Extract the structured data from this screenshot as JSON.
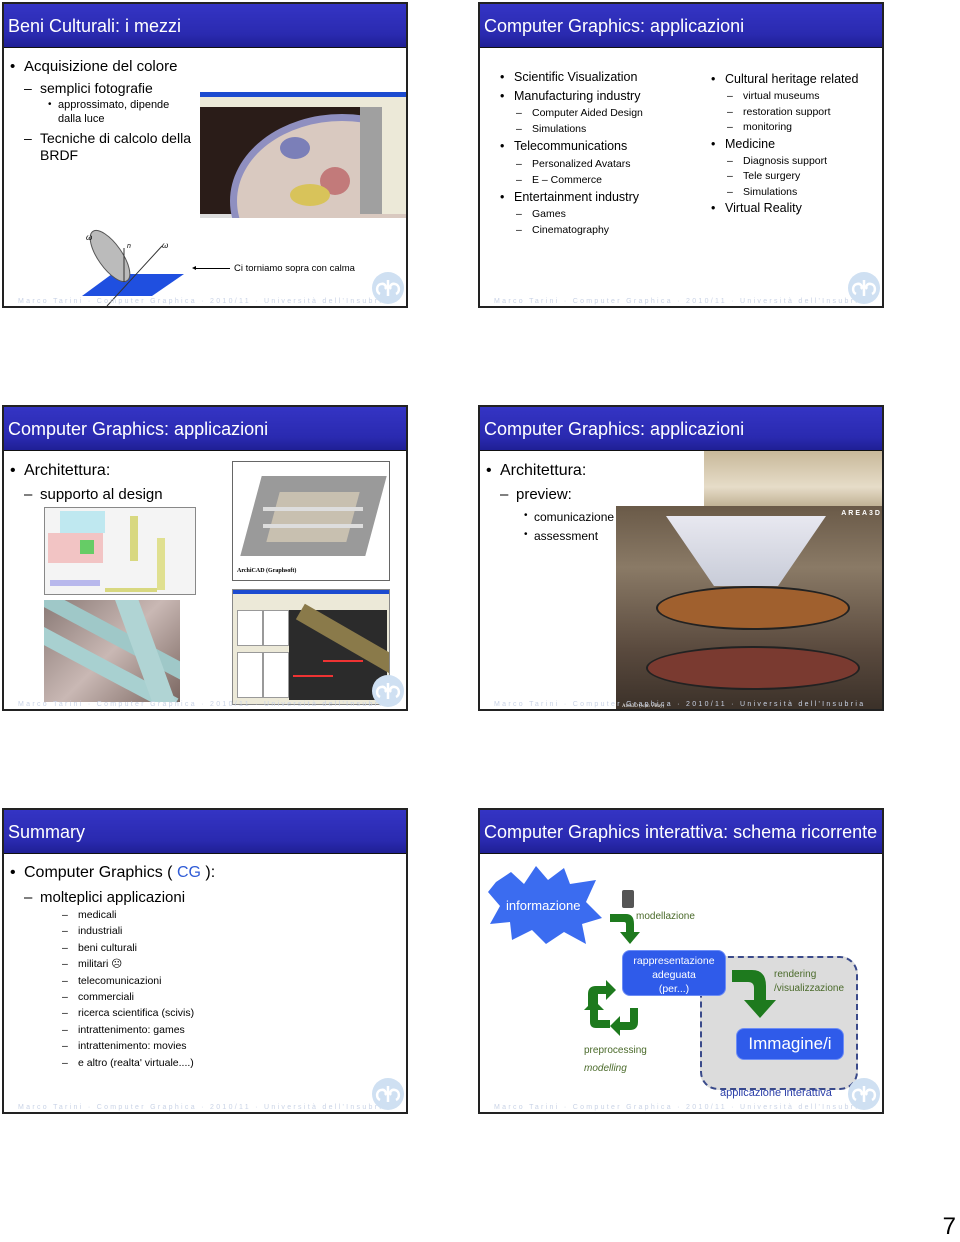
{
  "footer_text": "Marco Tarini · Computer Graphica · 2010/11 · Università dell'Insubria",
  "page_number": "7",
  "slides": [
    {
      "title": "Beni Culturali: i mezzi",
      "bullets": {
        "b1": "Acquisizione del colore",
        "d1": "semplici fotografie",
        "s1": "approssimato, dipende",
        "s1b": "dalla luce",
        "d2": "Tecniche di calcolo della",
        "d2b": "BRDF"
      },
      "note": "Ci torniamo sopra con calma",
      "brdf_labels": {
        "wo": "ω",
        "n": "n",
        "wi": "ω"
      },
      "images": [
        "plate-scan-software-screenshot",
        "brdf-lobe-diagram"
      ]
    },
    {
      "title": "Computer Graphics: applicazioni",
      "left": [
        {
          "level": 1,
          "text": "Scientific Visualization"
        },
        {
          "level": 1,
          "text": "Manufacturing industry"
        },
        {
          "level": 2,
          "text": "Computer Aided Design"
        },
        {
          "level": 2,
          "text": "Simulations"
        },
        {
          "level": 1,
          "text": "Telecommunications"
        },
        {
          "level": 2,
          "text": "Personalized Avatars"
        },
        {
          "level": 2,
          "text": "E – Commerce"
        },
        {
          "level": 1,
          "text": "Entertainment industry"
        },
        {
          "level": 2,
          "text": "Games"
        },
        {
          "level": 2,
          "text": "Cinematography"
        }
      ],
      "right": [
        {
          "level": 1,
          "text": "Cultural heritage related"
        },
        {
          "level": 2,
          "text": "virtual museums"
        },
        {
          "level": 2,
          "text": "restoration support"
        },
        {
          "level": 2,
          "text": "monitoring"
        },
        {
          "level": 1,
          "text": "Medicine"
        },
        {
          "level": 2,
          "text": "Diagnosis support"
        },
        {
          "level": 2,
          "text": "Tele surgery"
        },
        {
          "level": 2,
          "text": "Simulations"
        },
        {
          "level": 1,
          "text": "Virtual Reality"
        }
      ]
    },
    {
      "title": "Computer Graphics: applicazioni",
      "b1": "Architettura:",
      "d1": "supporto al design",
      "caption": "ArchiCAD (Graphsoft)",
      "images": [
        "hvac-floor-plan",
        "archicad-3d-model",
        "pipes-render",
        "cad-software-screenshot"
      ]
    },
    {
      "title": "Computer Graphics: applicazioni",
      "b1": "Architettura:",
      "d1": "preview:",
      "s1": "comunicazione",
      "s2": "assessment",
      "brand": "AREA3D",
      "caption": "Area3D (with VRay)",
      "images": [
        "interior-ceiling-render",
        "museum-interior-render"
      ]
    },
    {
      "title": "Summary",
      "b1_pre": "Computer Graphics ( ",
      "b1_cg": "CG",
      "b1_post": " ):",
      "d1": "molteplici applicazioni",
      "items": [
        "medicali",
        "industriali",
        "beni culturali",
        "militari ☹",
        "telecomunicazioni",
        "commerciali",
        "ricerca scientifica (scivis)",
        "intrattenimento: games",
        "intrattenimento: movies",
        "e altro (realta' virtuale....)"
      ],
      "accent_color": "#2f5bd6"
    },
    {
      "title": "Computer Graphics interattiva: schema ricorrente",
      "informazione": "informazione",
      "modellazione": "modellazione",
      "rappresentazione": [
        "rappresentazione",
        "adeguata",
        "(per...)"
      ],
      "rendering": [
        "rendering",
        "/visualizzazione"
      ],
      "immagine": "Immagine/i",
      "preprocessing": "preprocessing",
      "modelling": "modelling",
      "app_label": "applicazione interattiva",
      "colors": {
        "box": "#2f5bea",
        "arrow": "#1e7a1e",
        "label_green": "#4a6a2a",
        "app_label": "#2a3ea8"
      }
    }
  ]
}
